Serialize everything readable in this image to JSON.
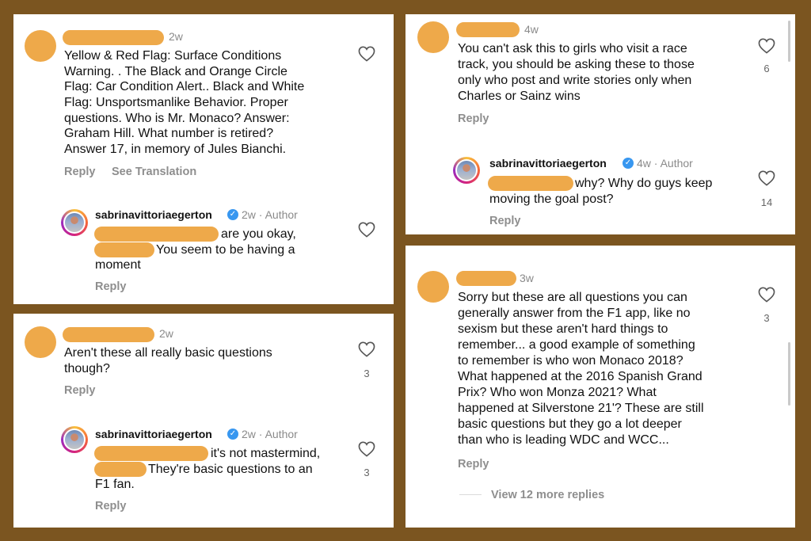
{
  "panel1": {
    "time": "2w",
    "text": [
      "Yellow & Red Flag: Surface Conditions",
      "Warning. . The Black and Orange Circle",
      "Flag: Car Condition Alert.. Black and White",
      "Flag: Unsportsmanlike Behavior. Proper",
      "questions. Who is Mr. Monaco? Answer:",
      "Graham Hill. What number is retired?",
      "Answer 17, in memory of Jules Bianchi."
    ],
    "reply": "Reply",
    "see_translation": "See Translation",
    "sub": {
      "username": "sabrinavittoriaegerton",
      "meta": "2w · Author",
      "text": [
        "are you okay,",
        "You seem to be having a",
        "moment"
      ],
      "reply": "Reply"
    }
  },
  "panel2": {
    "time": "2w",
    "text": [
      "Aren't these all really basic questions",
      "though?"
    ],
    "likes": "3",
    "reply": "Reply",
    "sub": {
      "username": "sabrinavittoriaegerton",
      "meta": "2w · Author",
      "text": [
        "it's not mastermind,",
        "They're basic questions to an",
        "F1 fan."
      ],
      "likes": "3",
      "reply": "Reply"
    }
  },
  "panel3": {
    "time": "4w",
    "text": [
      "You can't ask this to girls who visit a race",
      "track, you should be asking these to those",
      "only who post and write stories only when",
      "Charles or Sainz wins"
    ],
    "likes": "6",
    "reply": "Reply",
    "sub": {
      "username": "sabrinavittoriaegerton",
      "meta": "4w · Author",
      "text": [
        "why? Why do guys keep",
        "moving the goal post?"
      ],
      "likes": "14",
      "reply": "Reply"
    }
  },
  "panel4": {
    "time": "3w",
    "text": [
      "Sorry but these are all questions you can",
      "generally answer from the F1 app, like no",
      "sexism but these aren't hard things to",
      "remember... a good example of something",
      "to remember is who won Monaco 2018?",
      "What happened at the 2016 Spanish Grand",
      "Prix? Who won Monza 2021? What",
      "happened at Silverstone 21'? These are still",
      "basic questions but they go a lot deeper",
      "than who is leading WDC and WCC..."
    ],
    "likes": "3",
    "reply": "Reply",
    "view_more": "View 12 more replies"
  },
  "colors": {
    "frame": "#7b5520",
    "redaction": "#eea94a",
    "verified": "#3897f0"
  },
  "icons": {
    "like": "heart-icon",
    "verified": "verified-badge-icon"
  }
}
